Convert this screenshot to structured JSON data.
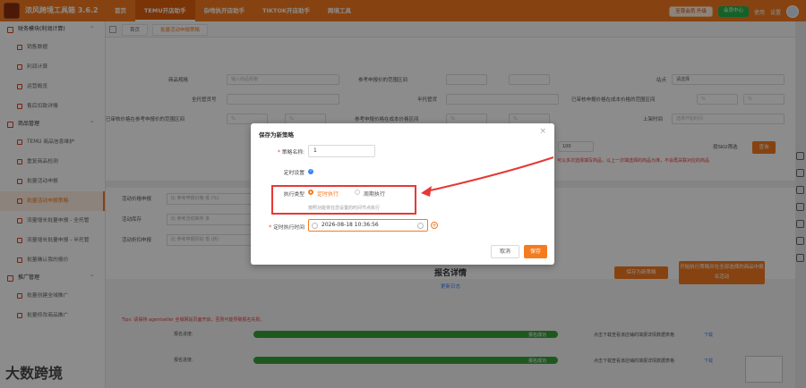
{
  "app": {
    "title": "浓风跨境工具箱 3.6.2"
  },
  "nav": [
    "首页",
    "TEMU开店助手",
    "杂啥执开店助手",
    "TIKTOK开店助手",
    "跨境工具"
  ],
  "top_right": {
    "vip": "至尊会员 升级",
    "green": "会员中心",
    "help": "使用",
    "settings": "设置"
  },
  "sidebar": {
    "groups": [
      {
        "label": "财务模块(利润计算)",
        "items": [
          "销售数据",
          "利润计算",
          "运营概览",
          "售后扣款详情"
        ]
      },
      {
        "label": "商品管理",
        "items": [
          "TEMU 商品信息维护",
          "重复商品检测",
          "批量活动申报",
          "批量活动申报策略",
          "流量增长批量申报 - 全托管",
          "流量增长批量申报 - 半托管",
          "批量确认我的报价"
        ]
      },
      {
        "label": "推广管理",
        "items": [
          "批量创建全域推广",
          "批量修改商品推广"
        ]
      }
    ]
  },
  "watermark": "大数跨境",
  "tabs": [
    "首页",
    "批量活动申报策略"
  ],
  "form": {
    "labels": [
      "商品规格",
      "参考申报价的范围区间",
      "全托管货号",
      "半托管货",
      "活动库存",
      "已审核价格在参考价格比",
      "已审核价格在参考申报价的范围区间",
      "参考申报价格在成本价格区间",
      "上架时间",
      "站点",
      "已审核申报价格在成本价格的范围区间"
    ],
    "placeholders": [
      "输入商品规格",
      "请选择",
      "请选择",
      "选择开始时间"
    ],
    "percent": "%",
    "hundred": "100",
    "sku_label": "按SKU筛选",
    "search_button": "查询",
    "red_note": "可以多次选择填写商品，以上一次填选择的商品为准，不会再关联对应的商品"
  },
  "section2": {
    "rows": [
      {
        "label": "活动价格申报",
        "placeholder": "比 参考申报价格 低 (%)"
      },
      {
        "label": "活动库存",
        "placeholder": "比 参考活动库存 多"
      },
      {
        "label": "活动折扣申报",
        "placeholder": "比 参考申报折扣 低 (折)"
      }
    ],
    "save_strategy": "保存为新策略",
    "start_button": "开始执行策略并在全部选择的商品中报名活动",
    "detail_title": "报名详情",
    "detail_link": "更新日志",
    "tip": "Tips: 请保持 agentseller 全域网站页面开启，否则可能导致报名失败。",
    "progress_rows": [
      {
        "label": "报名进度:",
        "pct": 100,
        "status": "报名成功",
        "right_text": "点击下载查看该店铺的填报详情数据表格",
        "link": "下载"
      },
      {
        "label": "报名进度:",
        "pct": 100,
        "status": "报名成功",
        "right_text": "点击下载查看该店铺的填报详情数据表格",
        "link": "下载"
      }
    ]
  },
  "dialog": {
    "title": "保存为新策略",
    "name_label": "策略名称:",
    "name_value": "1",
    "timing_label": "定时设置",
    "exec_type_label": "执行类型",
    "option_once": "定时执行",
    "option_periodic": "周期执行",
    "hint": "按照功能将在您设置的时间节点执行",
    "time_label": "定时执行时间",
    "time_value": "2026-08-18 10:36:56",
    "cancel": "取消",
    "save": "保存"
  },
  "colors": {
    "brand": "#f47b20",
    "danger": "#e53935",
    "success": "#3aa13a",
    "link": "#3b82f6"
  }
}
